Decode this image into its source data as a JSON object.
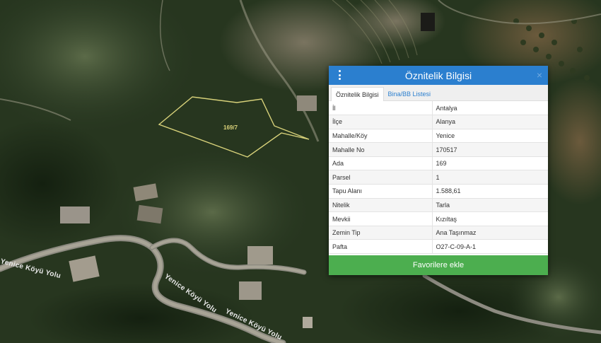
{
  "map": {
    "parcel_label": "169/7",
    "roads": [
      "Yenice Köyü Yolu",
      "Yenice Köyü Yolu",
      "Yenice Köyü Yolu"
    ]
  },
  "panel": {
    "title": "Öznitelik Bilgisi",
    "tabs": [
      {
        "label": "Öznitelik Bilgisi",
        "active": true
      },
      {
        "label": "Bina/BB Listesi",
        "active": false
      }
    ],
    "rows": [
      {
        "key": "İl",
        "value": "Antalya"
      },
      {
        "key": "İlçe",
        "value": "Alanya"
      },
      {
        "key": "Mahalle/Köy",
        "value": "Yenice"
      },
      {
        "key": "Mahalle No",
        "value": "170517"
      },
      {
        "key": "Ada",
        "value": "169"
      },
      {
        "key": "Parsel",
        "value": "1"
      },
      {
        "key": "Tapu Alanı",
        "value": "1.588,61"
      },
      {
        "key": "Nitelik",
        "value": "Tarla"
      },
      {
        "key": "Mevkii",
        "value": "Kızıltaş"
      },
      {
        "key": "Zemin Tip",
        "value": "Ana Taşınmaz"
      },
      {
        "key": "Pafta",
        "value": "O27-C-09-A-1"
      }
    ],
    "button_label": "Favorilere ekle",
    "close_glyph": "×"
  },
  "icons": {
    "menu": "vertical-dots-icon",
    "close": "close-icon"
  },
  "colors": {
    "header": "#2b7fcf",
    "button": "#4cae4f",
    "parcel_outline": "#d8d27a"
  }
}
